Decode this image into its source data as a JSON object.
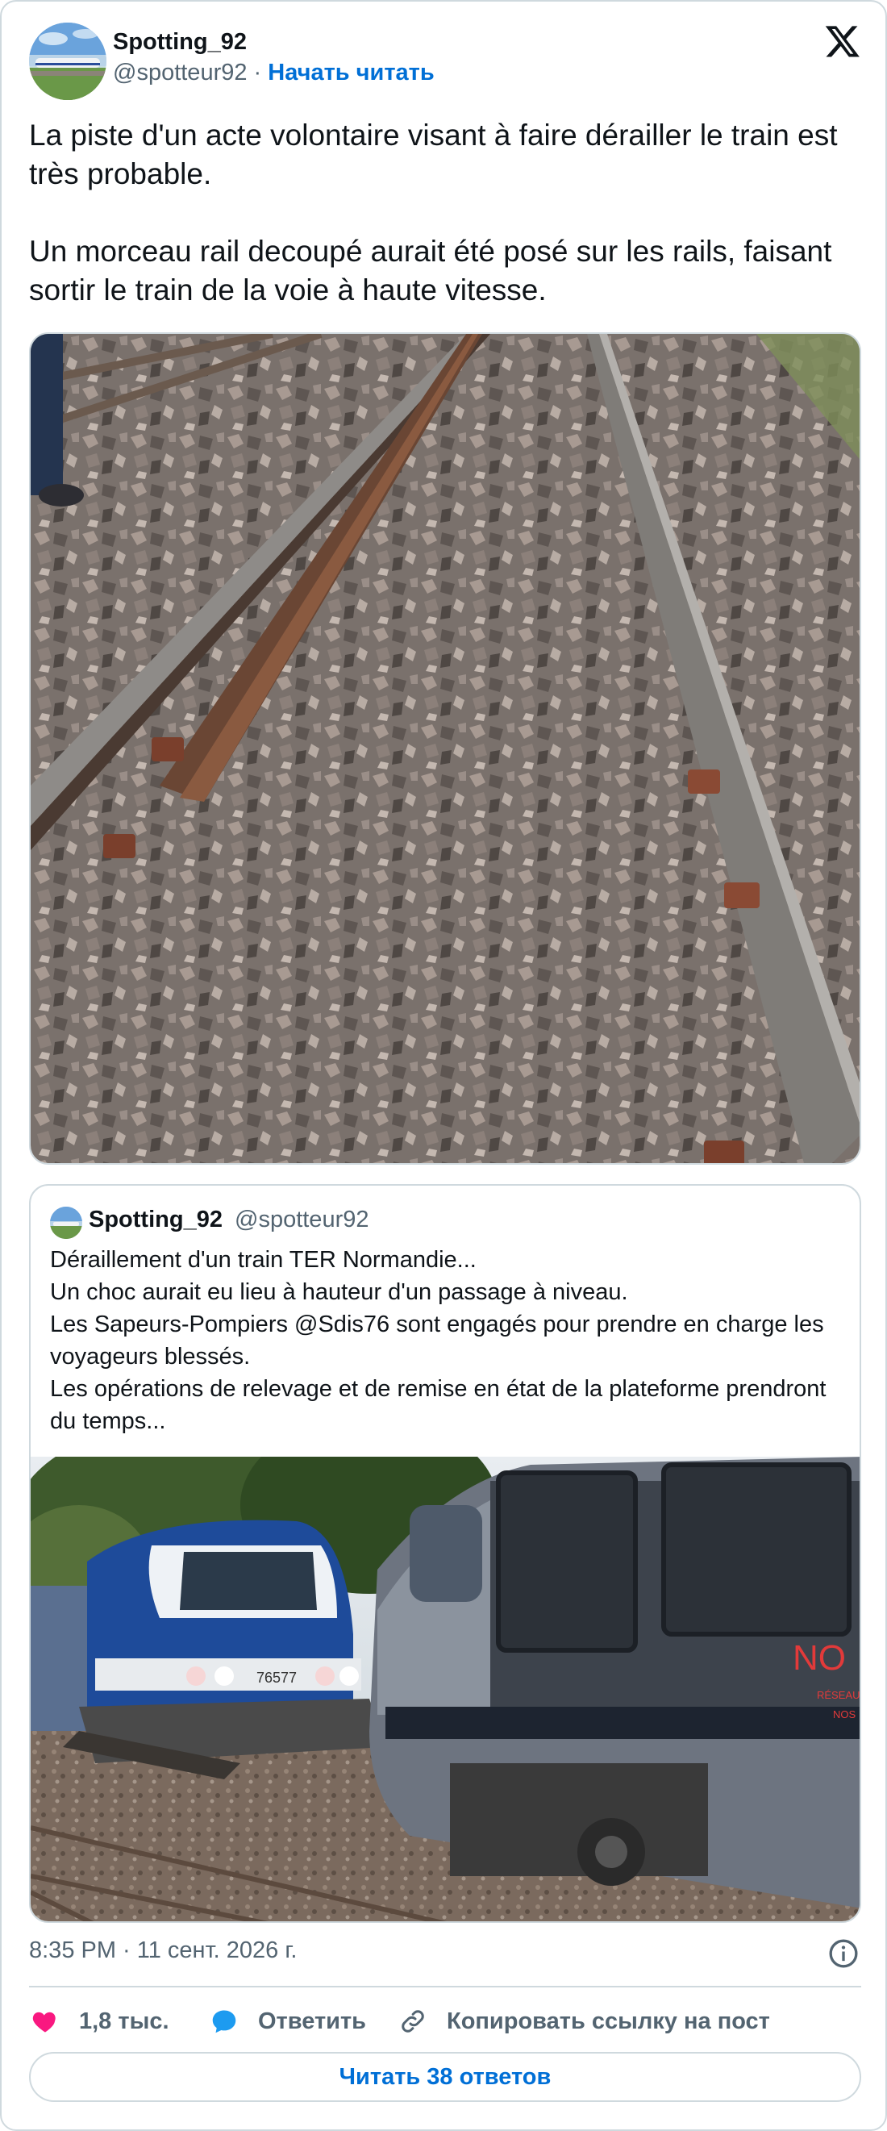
{
  "author": {
    "name": "Spotting_92",
    "handle": "@spotteur92",
    "separator": "·",
    "follow_label": "Начать читать"
  },
  "tweet": {
    "paragraph1": "La piste d'un acte volontaire visant à faire dérailler le train est très probable.",
    "paragraph2": "Un morceau rail decoupé aurait été posé sur les rails, faisant sortir le train de la voie à haute vitesse."
  },
  "quoted": {
    "name": "Spotting_92",
    "handle": "@spotteur92",
    "lines": [
      "Déraillement d'un train TER Normandie...",
      "Un choc aurait eu lieu à hauteur d'un passage à niveau.",
      "Les Sapeurs-Pompiers @Sdis76 sont engagés pour prendre en charge les voyageurs blessés.",
      "Les opérations de relevage et de remise en état de la plateforme prendront du temps..."
    ],
    "train_number": "76577",
    "livery_text": "NO",
    "livery_small1": "RÉSEAU",
    "livery_small2": "NOS"
  },
  "footer": {
    "timestamp": "8:35 PM · 11 сент. 2026 г.",
    "likes": "1,8 тыс.",
    "reply_label": "Ответить",
    "copy_label": "Копировать ссылку на пост",
    "read_replies_label": "Читать 38 ответов"
  },
  "colors": {
    "like": "#f91880",
    "reply": "#1d9bf0",
    "link": "#006fd6",
    "muted": "#536471",
    "border": "#cfd9de"
  },
  "icons": [
    "x-logo-icon",
    "info-icon",
    "heart-icon",
    "reply-bubble-icon",
    "link-icon"
  ]
}
